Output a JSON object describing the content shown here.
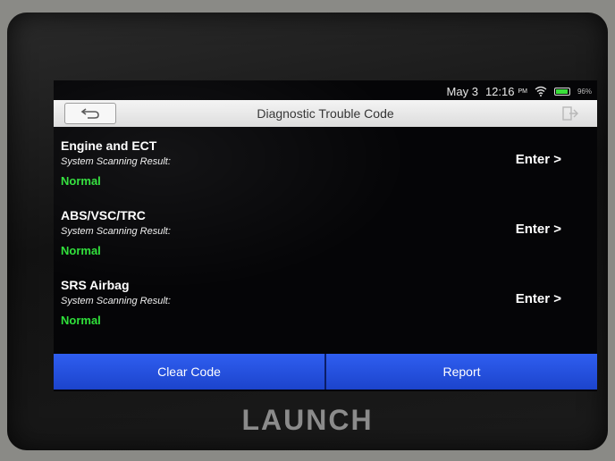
{
  "status": {
    "date": "May 3",
    "time": "12:16",
    "ampm": "PM",
    "battery_text": "96%",
    "battery_level": 0.96,
    "icons": [
      "wifi-icon",
      "battery-icon"
    ]
  },
  "header": {
    "title": "Diagnostic Trouble Code",
    "back_icon": "back-arrow-icon",
    "exit_icon": "exit-icon"
  },
  "systems": [
    {
      "name": "Engine and ECT",
      "result_label": "System Scanning Result:",
      "result": "Normal",
      "action": "Enter >"
    },
    {
      "name": "ABS/VSC/TRC",
      "result_label": "System Scanning Result:",
      "result": "Normal",
      "action": "Enter >"
    },
    {
      "name": "SRS Airbag",
      "result_label": "System Scanning Result:",
      "result": "Normal",
      "action": "Enter >"
    }
  ],
  "actions": {
    "clear_code": "Clear Code",
    "report": "Report"
  },
  "device": {
    "brand": "LAUNCH"
  },
  "colors": {
    "accent": "#2f5ef0",
    "normal": "#2fe03a"
  }
}
